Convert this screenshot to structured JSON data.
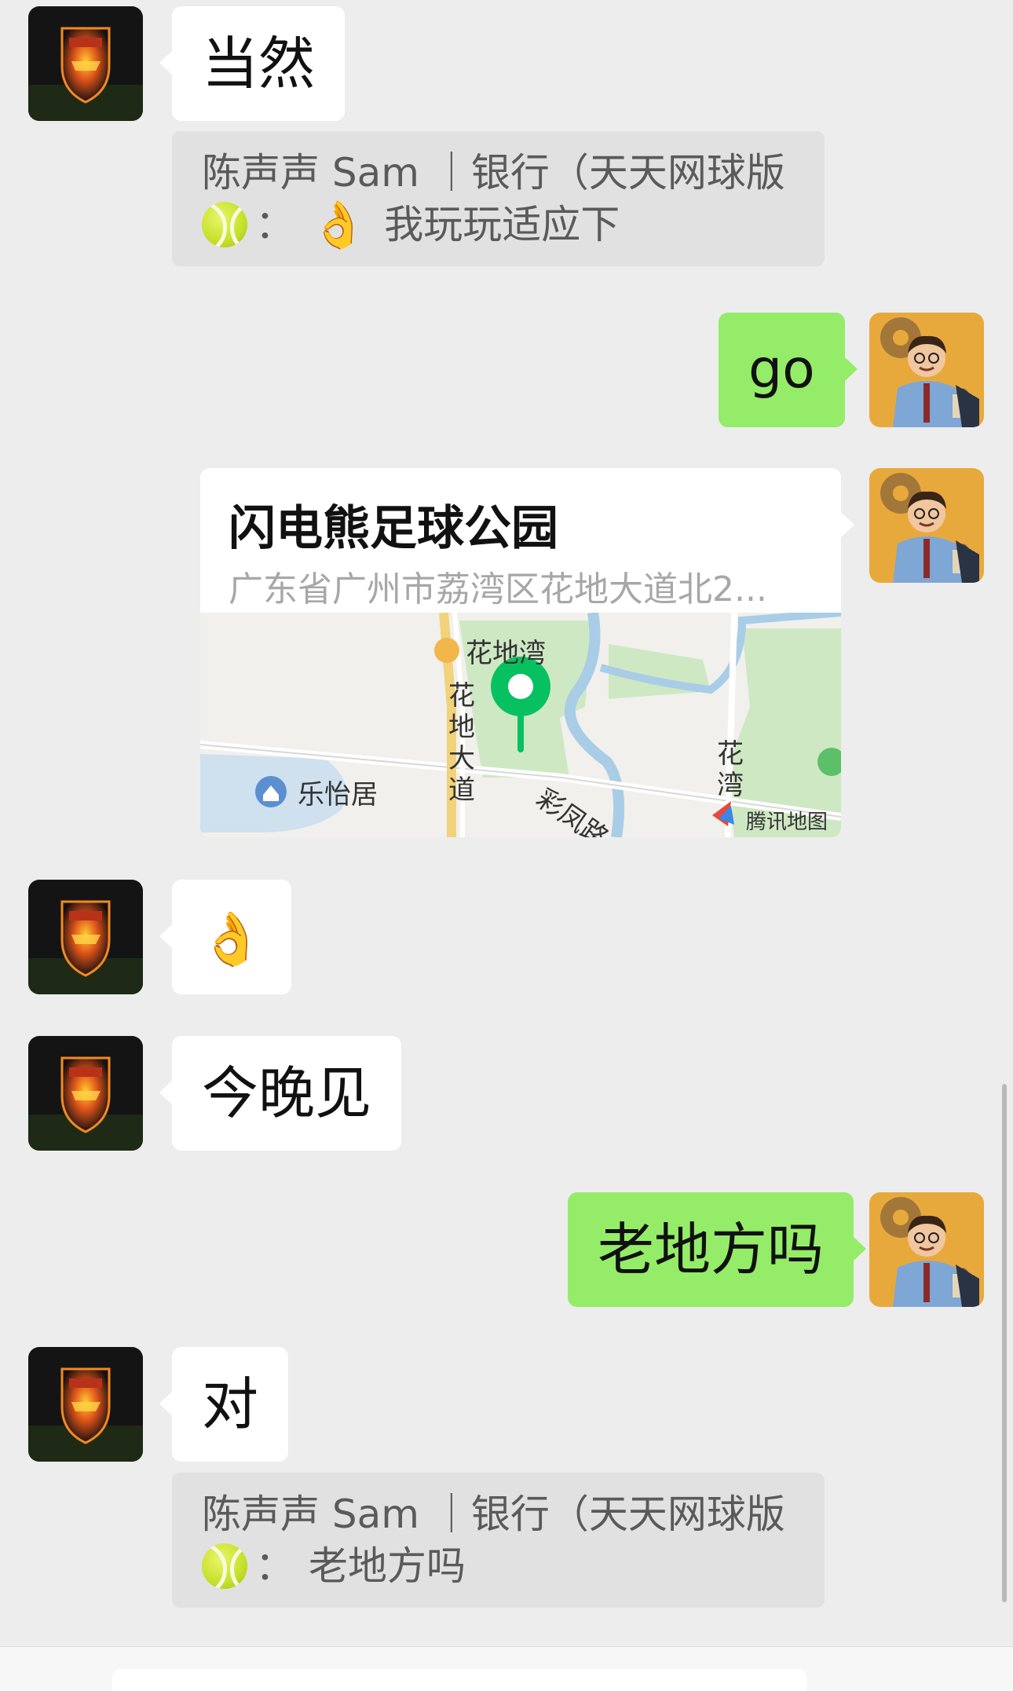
{
  "messages": {
    "m1": {
      "text": "当然"
    },
    "q1": {
      "line1": "陈声声 Sam ｜银行（天天网球版",
      "line2_text": "我玩玩适应下"
    },
    "m2": {
      "text": "go"
    },
    "location": {
      "title": "闪电熊足球公园",
      "address": "广东省广州市荔湾区花地大道北2...",
      "map": {
        "labels": {
          "huadiwan": "花地湾",
          "huadi_road": "花地大道",
          "leyiju": "乐怡居",
          "caifeng_road": "彩凤路",
          "huawan": "花湾",
          "provider": "腾讯地图"
        }
      }
    },
    "m3": {
      "emoji": "👌"
    },
    "m4": {
      "text": "今晚见"
    },
    "m5": {
      "text": "老地方吗"
    },
    "m6": {
      "text": "对"
    },
    "q2": {
      "line1": "陈声声 Sam ｜银行（天天网球版",
      "line2_text": "老地方吗"
    }
  },
  "colors": {
    "background": "#ededed",
    "bubble_self": "#95ec69",
    "bubble_other": "#ffffff",
    "quote_bg": "#e1e1e1",
    "pin": "#07c160"
  },
  "icons": {
    "other_avatar": "arsenal-crest-avatar",
    "self_avatar": "cartoon-man-avatar",
    "tennis_ball": "tennis-ball-emoji",
    "ok_hand": "ok-hand-emoji",
    "map_pin": "map-pin-icon"
  }
}
